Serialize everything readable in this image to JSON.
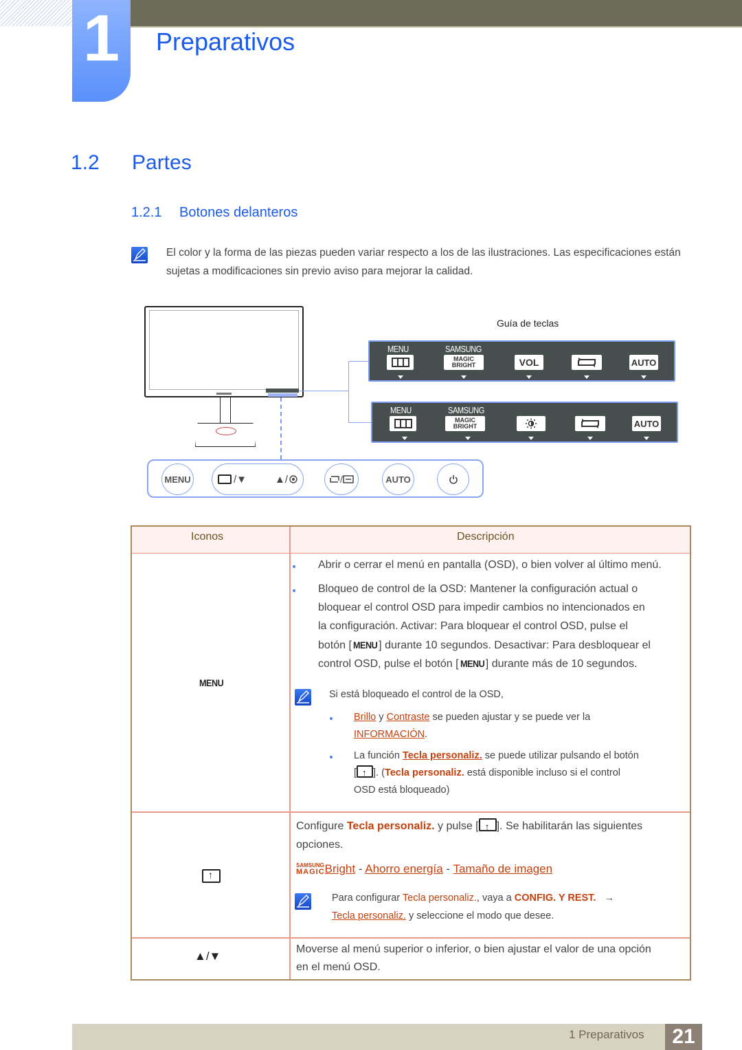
{
  "header": {
    "chapter_number": "1",
    "chapter_title": "Preparativos"
  },
  "section": {
    "number": "1.2",
    "title": "Partes"
  },
  "subsection": {
    "number": "1.2.1",
    "title": "Botones delanteros"
  },
  "intro_note": {
    "icon": "note-pencil-icon",
    "text": "El color y la forma de las piezas pueden variar respecto a los de las ilustraciones. Las especificaciones están sujetas a modificaciones sin previo aviso para mejorar la calidad."
  },
  "diagram": {
    "key_guide_label": "Guía de teclas",
    "panel_top": {
      "menu_label": "MENU",
      "samsung_label": "SAMSUNG",
      "keys": [
        "menu-icon",
        "MAGIC BRIGHT",
        "VOL",
        "source-icon",
        "AUTO"
      ]
    },
    "panel_bottom": {
      "menu_label": "MENU",
      "samsung_label": "SAMSUNG",
      "keys": [
        "menu-icon",
        "MAGIC BRIGHT",
        "brightness-icon",
        "source-icon",
        "AUTO"
      ]
    },
    "magic_line1": "MAGIC",
    "magic_line2": "BRIGHT",
    "vol_label": "VOL",
    "auto_label": "AUTO",
    "buttons": {
      "menu": "MENU",
      "custom_down": "/▼",
      "up_enter": "▲/",
      "source_sep": "/",
      "auto": "AUTO"
    }
  },
  "table": {
    "headers": {
      "icons": "Iconos",
      "description": "Descripción"
    },
    "row1": {
      "icon_label": "MENU",
      "bullet1": "Abrir o cerrar el menú en pantalla (OSD), o bien volver al último menú.",
      "bullet2_lines": [
        "Bloqueo de control de la OSD: Mantener la configuración actual o",
        "bloquear el control OSD para impedir cambios no intencionados en",
        "la configuración. Activar: Para bloquear el control OSD, pulse el"
      ],
      "bullet2_l4_a": "botón [",
      "bullet2_l4_key": "MENU",
      "bullet2_l4_b": "] durante 10 segundos. Desactivar: Para desbloquear el",
      "bullet2_l5_a": "control OSD, pulse el botón [",
      "bullet2_l5_key": "MENU",
      "bullet2_l5_b": "] durante más de 10 segundos.",
      "note_title": "Si está bloqueado el control de la OSD,",
      "note_b1_link1": "Brillo",
      "note_b1_and": " y ",
      "note_b1_link2": "Contraste",
      "note_b1_rest": " se pueden ajustar y se puede ver la",
      "note_b1_link3": "INFORMACIÓN",
      "note_b1_end": ".",
      "note_b2_a": "La función ",
      "note_b2_link": "Tecla personaliz.",
      "note_b2_b": " se puede utilizar pulsando el botón",
      "note_b2_c1": "[",
      "note_b2_c2": "]. (",
      "note_b2_bold": "Tecla personaliz.",
      "note_b2_d": " está disponible incluso si el control",
      "note_b2_e": "OSD está bloqueado)"
    },
    "row2": {
      "icon": "custom-key-icon",
      "l1_a": "Configure ",
      "l1_bold": "Tecla personaliz.",
      "l1_b": " y pulse [",
      "l1_c": "]. Se habilitarán las siguientes",
      "l2": "opciones.",
      "magic_top": "SAMSUNG",
      "magic_bottom": "MAGIC",
      "opt1": "Bright",
      "sep": " - ",
      "opt2": "Ahorro energía",
      "opt3": "Tamaño de imagen",
      "note_a": "Para configurar ",
      "note_bold1": "Tecla personaliz.",
      "note_b": ", vaya a ",
      "note_bold2": "CONFIG. Y REST.",
      "note_arrow": "→",
      "note_link": "Tecla personaliz.",
      "note_c": " y seleccione el modo que desee."
    },
    "row3": {
      "icon_label": "▲/▼",
      "text_lines": [
        "Moverse al menú superior o inferior, o bien ajustar el valor de una opción",
        "en el menú OSD."
      ]
    }
  },
  "footer": {
    "chapter_label": "1 Preparativos",
    "page_number": "21"
  }
}
